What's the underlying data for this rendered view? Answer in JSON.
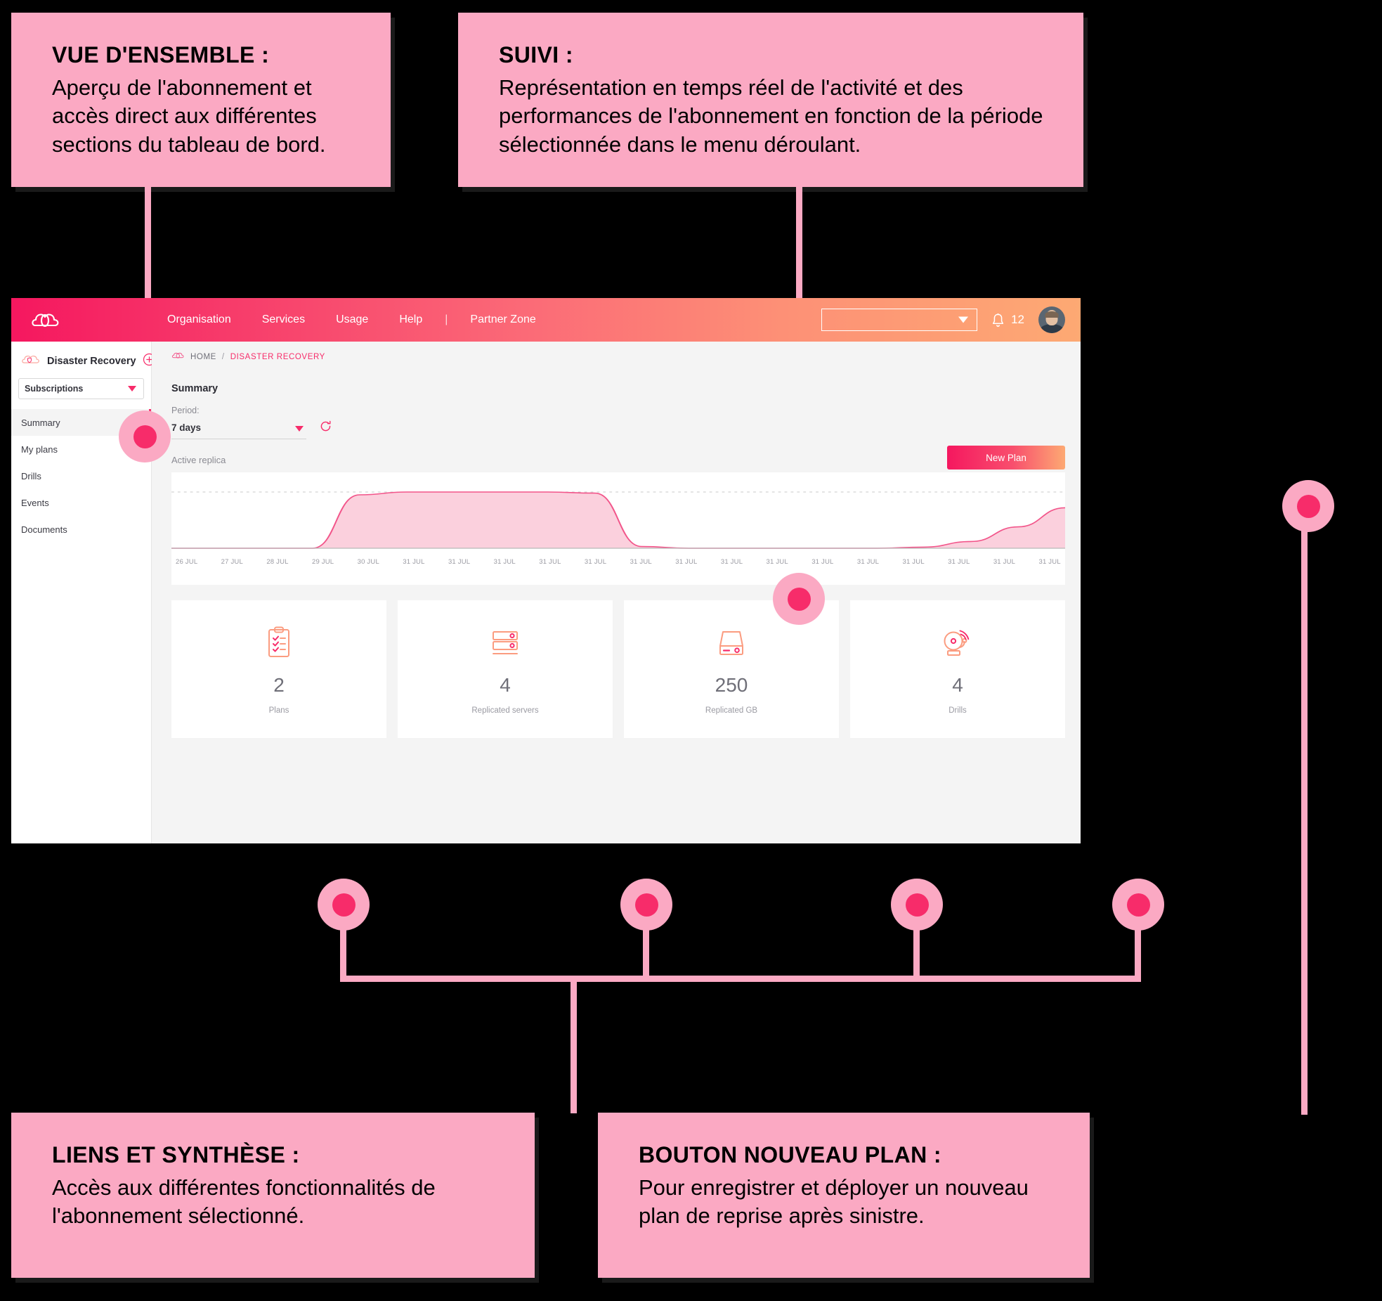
{
  "theme": {
    "accent_pink": "#F72C6A",
    "accent_orange": "#FDA973",
    "callout_bg": "#FBA9C3",
    "chart_fill": "#FBD0DD",
    "chart_stroke": "#F2558A"
  },
  "callouts": [
    {
      "id": "overview",
      "title": "VUE D'ENSEMBLE :",
      "body": "Aperçu de l'abonnement et accès direct aux différentes sections du tableau de bord."
    },
    {
      "id": "monitoring",
      "title": "SUIVI :",
      "body": "Représentation en temps réel de l'activité et des performances de l'abonnement en fonction de la période sélectionnée dans le menu déroulant."
    },
    {
      "id": "links",
      "title": "LIENS ET SYNTHÈSE :",
      "body": "Accès aux différentes fonctionnalités de l'abonnement sélectionné."
    },
    {
      "id": "newplan",
      "title": "BOUTON NOUVEAU PLAN :",
      "body": "Pour enregistrer et déployer un nouveau plan de reprise après sinistre."
    }
  ],
  "topnav": {
    "logo_icon": "cloud-logo-icon",
    "links": [
      "Organisation",
      "Services",
      "Usage"
    ],
    "help_label": "Help",
    "separator": "|",
    "partner_label": "Partner Zone",
    "selector_value": "",
    "selector_icon": "chevron-down-icon",
    "bell_icon": "bell-icon",
    "notification_count": "12",
    "avatar_icon": "user-avatar"
  },
  "sidebar": {
    "service_icon": "cloud-shield-icon",
    "service_title": "Disaster Recovery",
    "add_icon": "plus-circle-icon",
    "subscription_select": "Subscriptions",
    "items": [
      {
        "label": "Summary",
        "active": true
      },
      {
        "label": "My plans",
        "active": false
      },
      {
        "label": "Drills",
        "active": false
      },
      {
        "label": "Events",
        "active": false
      },
      {
        "label": "Documents",
        "active": false
      }
    ]
  },
  "main": {
    "breadcrumb": {
      "icon": "cloud-icon",
      "home": "HOME",
      "separator": "/",
      "current": "DISASTER RECOVERY"
    },
    "section_title": "Summary",
    "period_label": "Period:",
    "period_value": "7 days",
    "refresh_icon": "refresh-icon",
    "new_plan_label": "New Plan",
    "chart_label": "Active replica",
    "cards": [
      {
        "icon": "clipboard-checklist-icon",
        "value": "2",
        "caption": "Plans"
      },
      {
        "icon": "server-rack-icon",
        "value": "4",
        "caption": "Replicated servers"
      },
      {
        "icon": "hard-drive-icon",
        "value": "250",
        "caption": "Replicated GB"
      },
      {
        "icon": "alarm-bell-icon",
        "value": "4",
        "caption": "Drills"
      }
    ]
  },
  "chart_data": {
    "type": "area",
    "title": "Active replica",
    "xlabel": "",
    "ylabel": "",
    "grid": true,
    "legend": false,
    "categories": [
      "26 JUL",
      "27 JUL",
      "28 JUL",
      "29 JUL",
      "30 JUL",
      "31 JUL",
      "31 JUL",
      "31 JUL",
      "31 JUL",
      "31 JUL",
      "31 JUL",
      "31 JUL",
      "31 JUL",
      "31 JUL",
      "31 JUL",
      "31 JUL",
      "31 JUL",
      "31 JUL",
      "31 JUL",
      "31 JUL"
    ],
    "values": [
      0,
      0,
      0,
      0,
      95,
      100,
      100,
      100,
      100,
      98,
      3,
      0,
      0,
      0,
      0,
      0,
      2,
      12,
      38,
      72
    ],
    "ylim": [
      0,
      110
    ],
    "reference_line": 100
  }
}
